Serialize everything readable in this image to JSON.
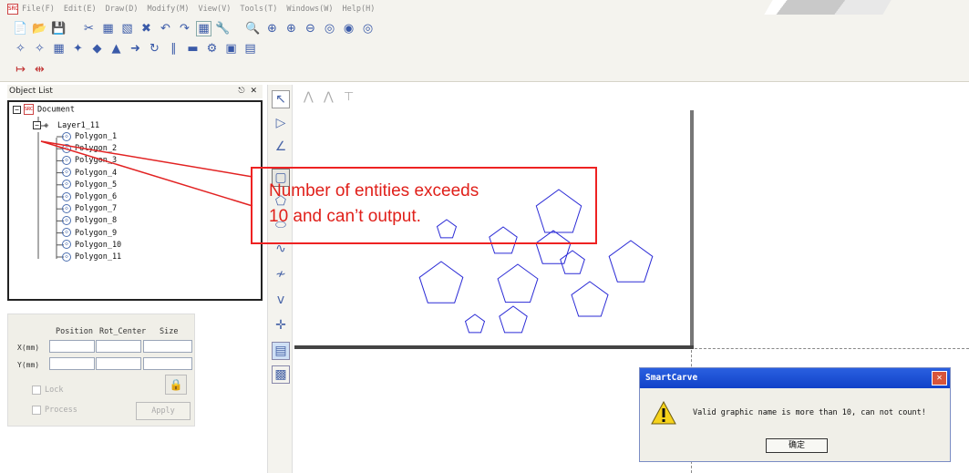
{
  "menubar": {
    "items": [
      "File(F)",
      "Edit(E)",
      "Draw(D)",
      "Modify(M)",
      "View(V)",
      "Tools(T)",
      "Windows(W)",
      "Help(H)"
    ]
  },
  "object_list": {
    "title": "Object List",
    "pin": "p",
    "close": "✕",
    "tree": {
      "document": "Document",
      "layer": "Layer1_11",
      "items": [
        "Polygon_1",
        "Polygon_2",
        "Polygon_3",
        "Polygon_4",
        "Polygon_5",
        "Polygon_6",
        "Polygon_7",
        "Polygon_8",
        "Polygon_9",
        "Polygon_10",
        "Polygon_11"
      ]
    }
  },
  "properties": {
    "headers": [
      "Position",
      "Rot_Center",
      "Size"
    ],
    "rows": [
      "X(mm)",
      "Y(mm)"
    ],
    "lock_label": "Lock",
    "process_label": "Process",
    "apply_label": "Apply"
  },
  "annotation": {
    "line1": "Number of entities exceeds",
    "line2": "10 and can’t output."
  },
  "dialog": {
    "title": "SmartCarve",
    "message": "Valid graphic name is more than 10, can not count!",
    "ok_label": "确定"
  },
  "colors": {
    "annotation": "#e22222",
    "polygon_stroke": "#2b2bd6",
    "dialog_title": "#1a4fd8"
  }
}
